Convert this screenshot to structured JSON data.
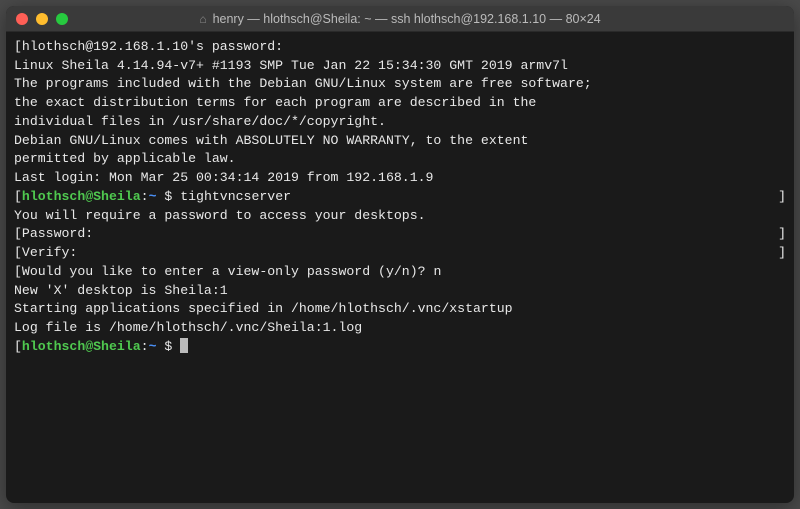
{
  "window": {
    "title": "henry — hlothsch@Sheila: ~ — ssh hlothsch@192.168.1.10 — 80×24"
  },
  "terminal": {
    "line01": "hlothsch@192.168.1.10's password:",
    "line02": "Linux Sheila 4.14.94-v7+ #1193 SMP Tue Jan 22 15:34:30 GMT 2019 armv7l",
    "blank1": "",
    "line03": "The programs included with the Debian GNU/Linux system are free software;",
    "line04": "the exact distribution terms for each program are described in the",
    "line05": "individual files in /usr/share/doc/*/copyright.",
    "blank2": "",
    "line06": "Debian GNU/Linux comes with ABSOLUTELY NO WARRANTY, to the extent",
    "line07": "permitted by applicable law.",
    "line08": "Last login: Mon Mar 25 00:34:14 2019 from 192.168.1.9",
    "prompt1": {
      "userhost": "hlothsch@Sheila",
      "colon": ":",
      "path": "~",
      "dollar": " $ ",
      "command": "tightvncserver"
    },
    "blank3": "",
    "line09": "You will require a password to access your desktops.",
    "blank4": "",
    "line10": "Password:",
    "line11": "Verify:",
    "line12": "Would you like to enter a view-only password (y/n)? n",
    "blank5": "",
    "line13": "New 'X' desktop is Sheila:1",
    "blank6": "",
    "line14": "Starting applications specified in /home/hlothsch/.vnc/xstartup",
    "line15": "Log file is /home/hlothsch/.vnc/Sheila:1.log",
    "blank7": "",
    "prompt2": {
      "userhost": "hlothsch@Sheila",
      "colon": ":",
      "path": "~",
      "dollar": " $ "
    },
    "lb": "[",
    "rb": "]"
  }
}
